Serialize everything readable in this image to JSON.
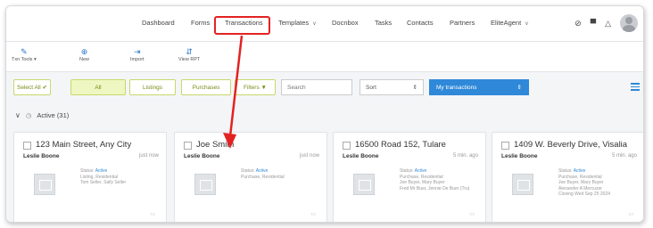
{
  "nav": {
    "items": [
      {
        "label": "Dashboard"
      },
      {
        "label": "Forms"
      },
      {
        "label": "Transactions"
      },
      {
        "label": "Templates"
      },
      {
        "label": "Docnbox"
      },
      {
        "label": "Tasks"
      },
      {
        "label": "Contacts"
      },
      {
        "label": "Partners"
      },
      {
        "label": "EliteAgent"
      }
    ],
    "help_icon": "?",
    "cart_icon": "cart-icon",
    "bell_icon": "bell-icon"
  },
  "toolbar": {
    "txn_tools": "Txn Tools",
    "new": "New",
    "import": "Import",
    "view_rpt": "View RPT"
  },
  "filters": {
    "select_all": "Select All",
    "all": "All",
    "listings": "Listings",
    "purchases": "Purchases",
    "filters": "Filters",
    "search_placeholder": "Search",
    "sort": "Sort",
    "my_transactions": "My transactions"
  },
  "section": {
    "title": "Active (31)"
  },
  "cards": [
    {
      "title": "123 Main Street, Any City",
      "agent": "Leslie Boone",
      "time": "just now",
      "status_label": "Status:",
      "status": "Active",
      "lines": [
        "Listing, Residential",
        "Tom Seller, Sally Seller"
      ]
    },
    {
      "title": "Joe Smith",
      "agent": "Leslie Boone",
      "time": "just now",
      "status_label": "Status:",
      "status": "Active",
      "lines": [
        "Purchase, Residential"
      ]
    },
    {
      "title": "16500 Road 152, Tulare",
      "agent": "Leslie Boone",
      "time": "5 min. ago",
      "status_label": "Status:",
      "status": "Active",
      "lines": [
        "Purchase, Residential",
        "Joe Buyer, Mary Buyer",
        "Fred Mr Buer, Jennie De Buer (Tru)"
      ]
    },
    {
      "title": "1409 W. Beverly Drive, Visalia",
      "agent": "Leslie Boone",
      "time": "5 min. ago",
      "status_label": "Status:",
      "status": "Active",
      "lines": [
        "Purchase, Residential",
        "Joe Buyer, Mary Buyer",
        "Alexander A Mercuzer",
        "Closing Wed Sep 25 2024"
      ]
    }
  ],
  "colors": {
    "accent": "#2f88d8",
    "highlight": "#e32222",
    "filter_green": "#c8d86a"
  }
}
